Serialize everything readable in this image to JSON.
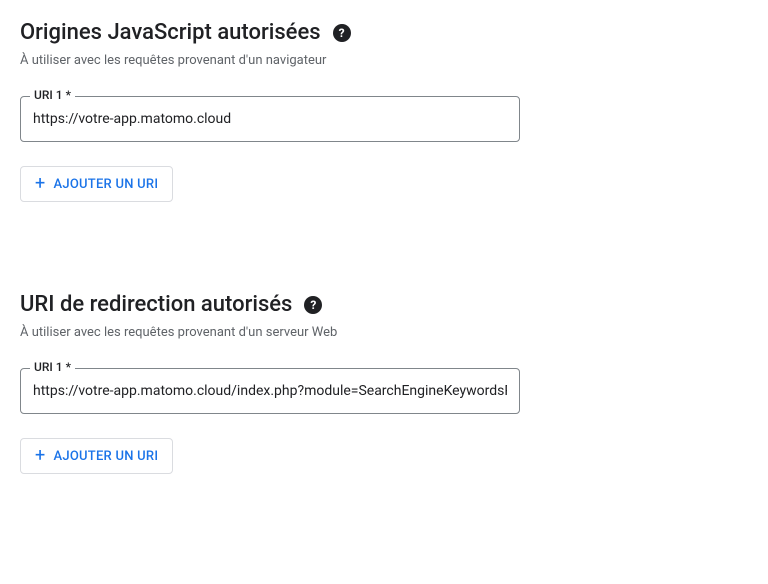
{
  "sections": [
    {
      "title": "Origines JavaScript autorisées",
      "description": "À utiliser avec les requêtes provenant d'un navigateur",
      "field": {
        "label": "URI 1 *",
        "value": "https://votre-app.matomo.cloud"
      },
      "addButton": "AJOUTER UN URI"
    },
    {
      "title": "URI de redirection autorisés",
      "description": "À utiliser avec les requêtes provenant d'un serveur Web",
      "field": {
        "label": "URI 1 *",
        "value": "https://votre-app.matomo.cloud/index.php?module=SearchEngineKeywordsP"
      },
      "addButton": "AJOUTER UN URI"
    }
  ],
  "helpSymbol": "?"
}
